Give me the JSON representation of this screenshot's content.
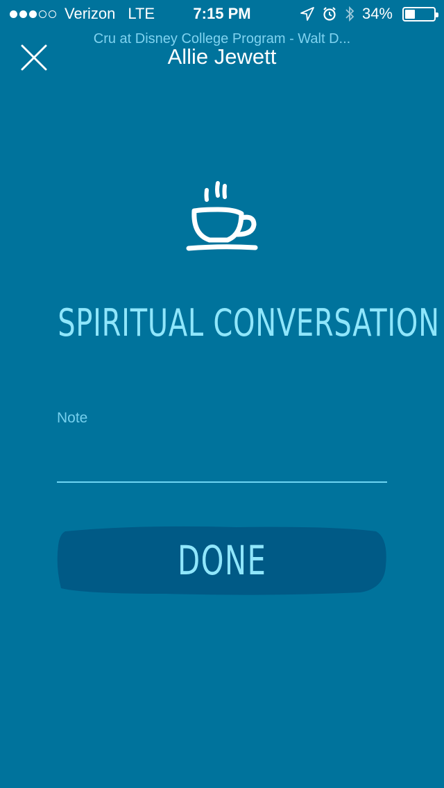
{
  "status_bar": {
    "carrier": "Verizon",
    "network": "LTE",
    "time": "7:15 PM",
    "battery": "34%",
    "battery_level": 0.34,
    "signal_bars_filled": 3,
    "signal_bars_total": 5
  },
  "nav": {
    "subtitle": "Cru at Disney College Program - Walt D...",
    "title": "Allie Jewett"
  },
  "main": {
    "heading": "SPIRITUAL CONVERSATION",
    "note_label": "Note",
    "note_value": "",
    "done_label": "DONE"
  },
  "colors": {
    "background": "#00739C",
    "accent": "#8fe6fb",
    "button": "#005A86"
  }
}
